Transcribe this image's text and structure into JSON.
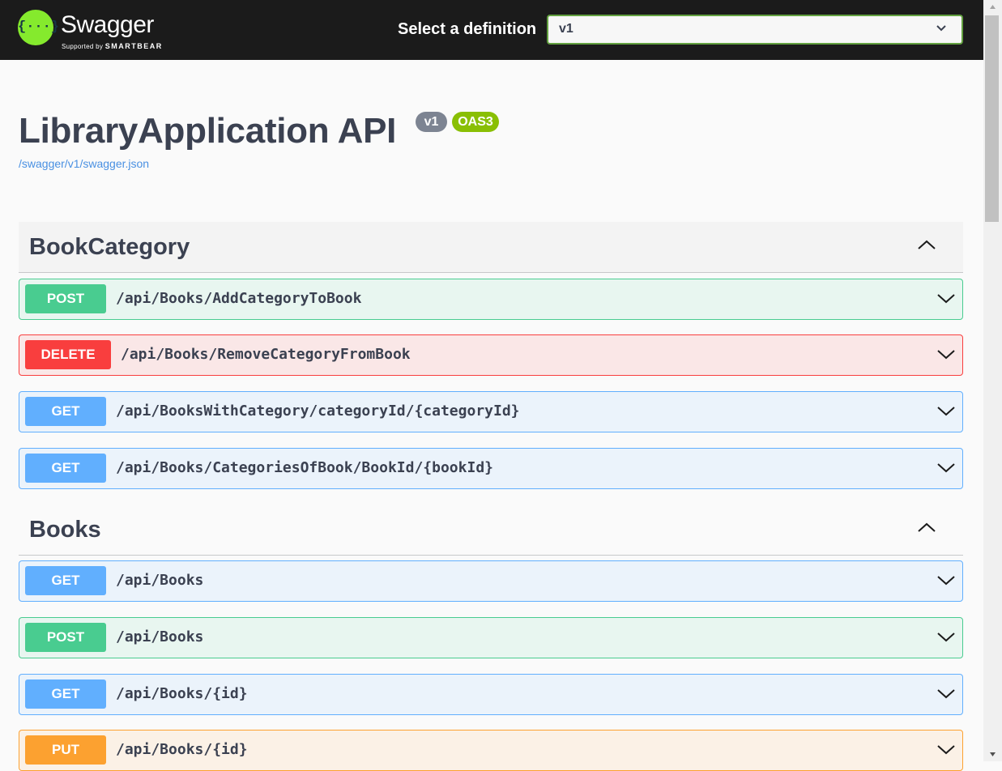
{
  "topbar": {
    "logo_glyph": "{···}",
    "brand": "Swagger",
    "brand_sub_prefix": "Supported by",
    "brand_sub_company": "SMARTBEAR",
    "definition_label": "Select a definition",
    "definition_value": "v1"
  },
  "info": {
    "title": "LibraryApplication API",
    "version_badge": "v1",
    "oas_badge": "OAS3",
    "spec_url": "/swagger/v1/swagger.json"
  },
  "sections": [
    {
      "name": "BookCategory",
      "operations": [
        {
          "method": "POST",
          "path": "/api/Books/AddCategoryToBook"
        },
        {
          "method": "DELETE",
          "path": "/api/Books/RemoveCategoryFromBook"
        },
        {
          "method": "GET",
          "path": "/api/BooksWithCategory/categoryId/{categoryId}"
        },
        {
          "method": "GET",
          "path": "/api/Books/CategoriesOfBook/BookId/{bookId}"
        }
      ]
    },
    {
      "name": "Books",
      "operations": [
        {
          "method": "GET",
          "path": "/api/Books"
        },
        {
          "method": "POST",
          "path": "/api/Books"
        },
        {
          "method": "GET",
          "path": "/api/Books/{id}"
        },
        {
          "method": "PUT",
          "path": "/api/Books/{id}"
        }
      ]
    }
  ],
  "colors": {
    "post": "#49cc90",
    "delete": "#f93e3e",
    "get": "#61affe",
    "put": "#fca130",
    "logo": "#85ea2d",
    "topbar": "#1b1b1b"
  }
}
